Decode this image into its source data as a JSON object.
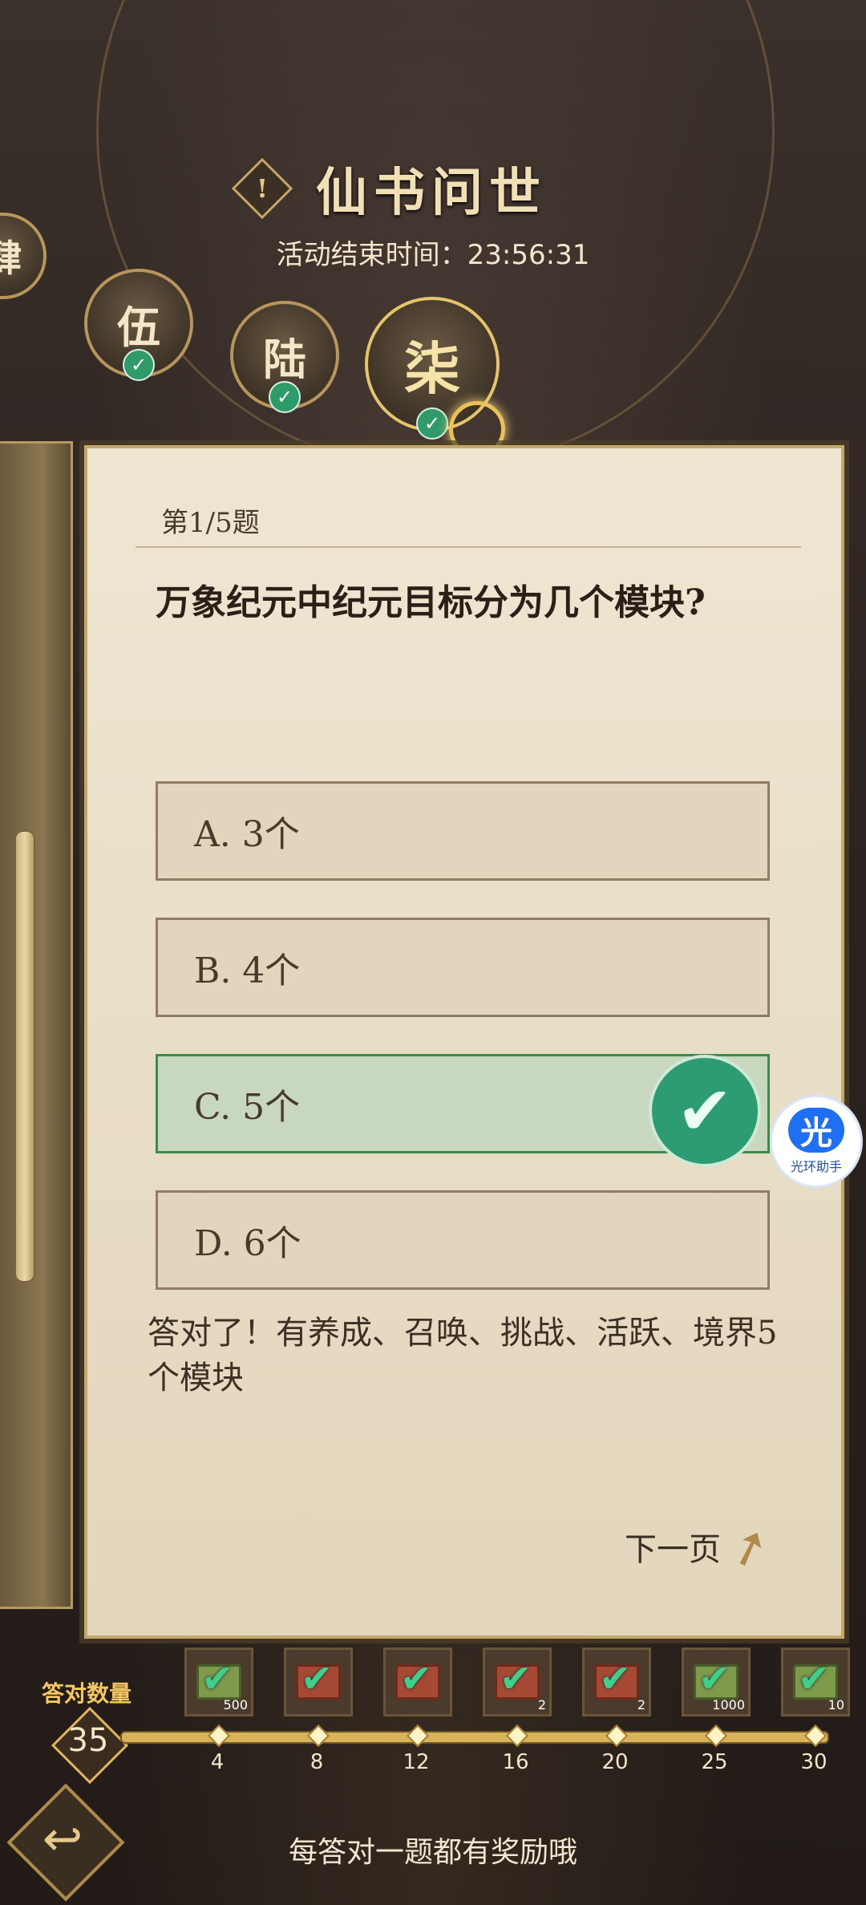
{
  "header": {
    "title": "仙书问世",
    "timer_label": "活动结束时间：",
    "timer_value": "23:56:31"
  },
  "chapters": [
    {
      "label": "肆"
    },
    {
      "label": "伍"
    },
    {
      "label": "陆"
    },
    {
      "label": "柒"
    }
  ],
  "quiz": {
    "progress": "第1/5题",
    "question": "万象纪元中纪元目标分为几个模块?",
    "options": [
      {
        "label": "A. 3个",
        "correct": false
      },
      {
        "label": "B. 4个",
        "correct": false
      },
      {
        "label": "C. 5个",
        "correct": true
      },
      {
        "label": "D. 6个",
        "correct": false
      }
    ],
    "explanation": "答对了！有养成、召唤、挑战、活跃、境界5个模块",
    "next_label": "下一页"
  },
  "helper": {
    "glyph": "光",
    "label": "光环助手"
  },
  "progress": {
    "label": "答对数量",
    "count": "35",
    "milestones": [
      "4",
      "8",
      "12",
      "16",
      "20",
      "25",
      "30"
    ],
    "rewards": [
      {
        "type": "item",
        "qty": "500"
      },
      {
        "type": "chest",
        "qty": ""
      },
      {
        "type": "chest",
        "qty": ""
      },
      {
        "type": "chest",
        "qty": "2"
      },
      {
        "type": "chest",
        "qty": "2"
      },
      {
        "type": "item",
        "qty": "1000"
      },
      {
        "type": "item",
        "qty": "10"
      }
    ]
  },
  "footer": {
    "tip": "每答对一题都有奖励哦"
  }
}
